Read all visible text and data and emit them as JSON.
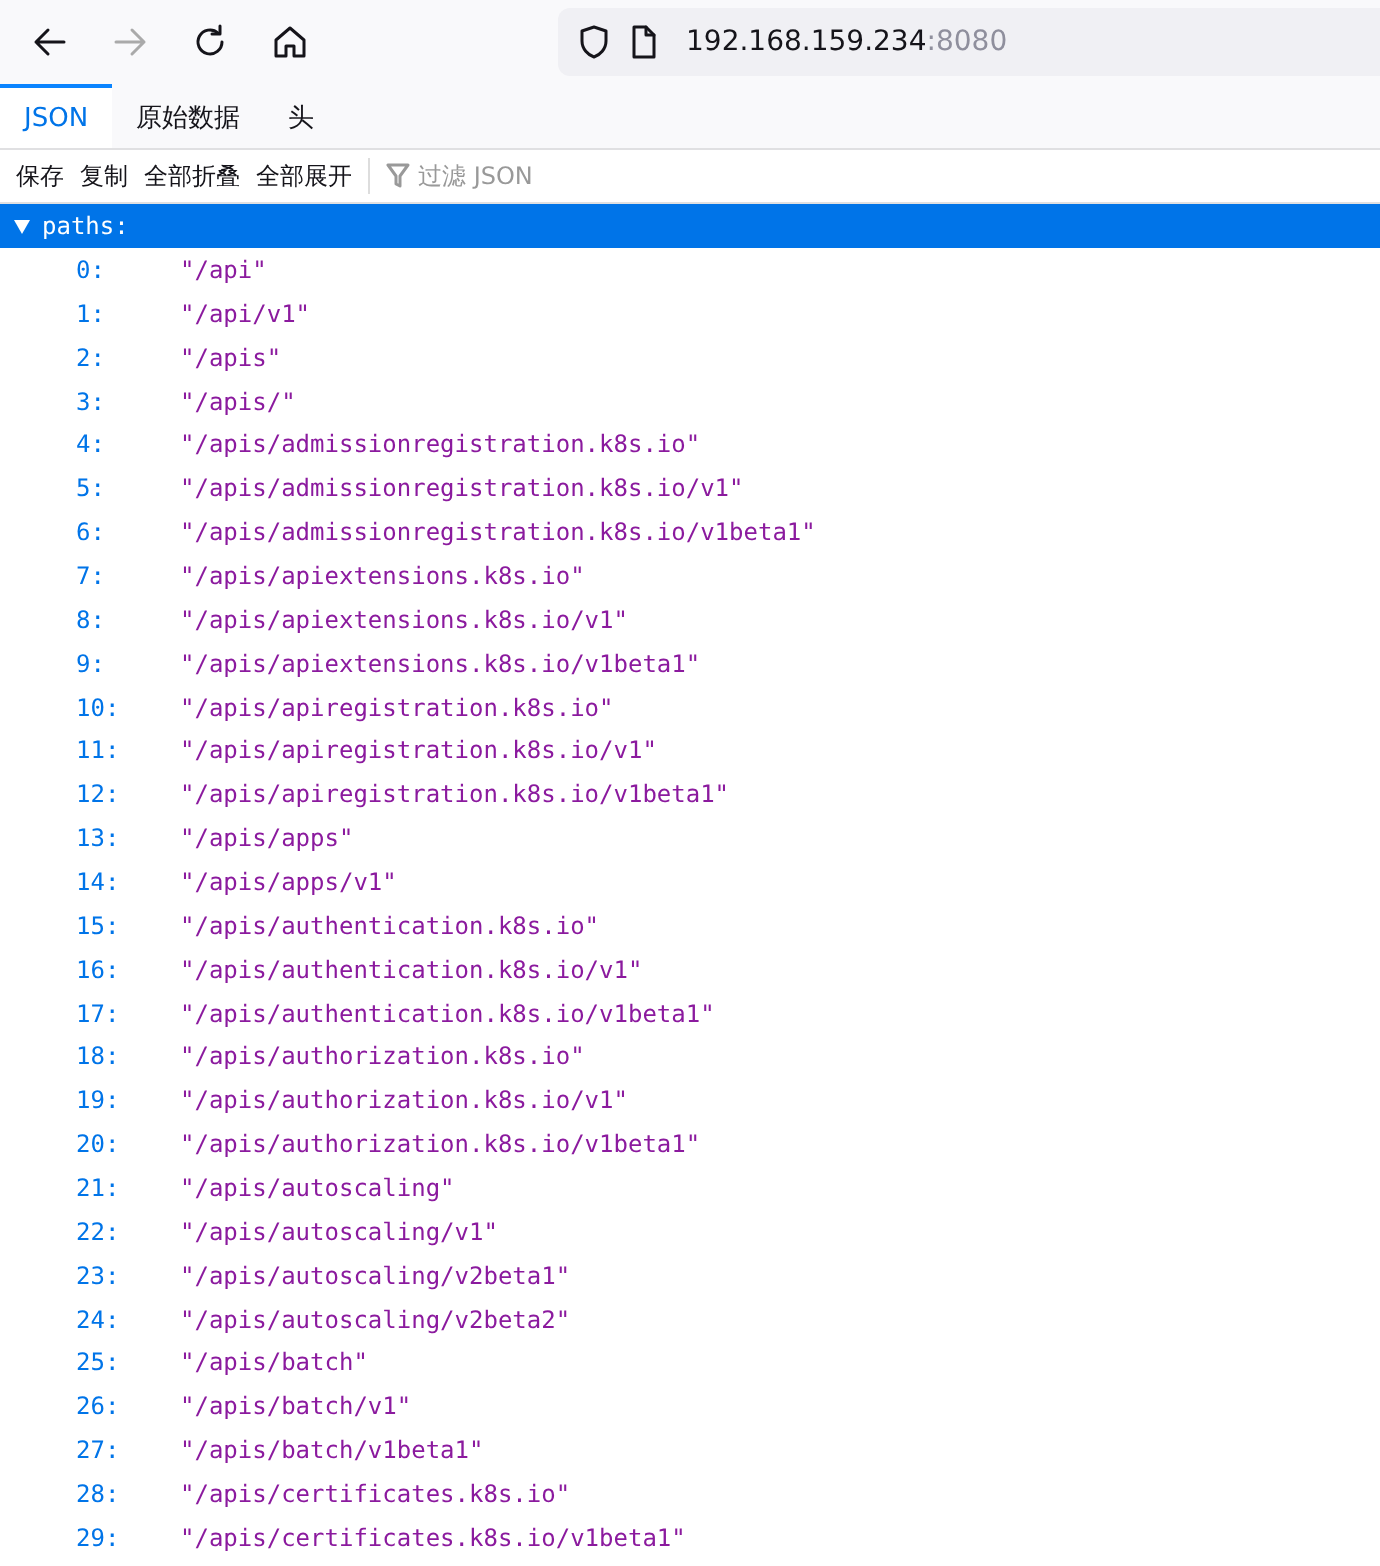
{
  "nav": {
    "host": "192.168.159.234",
    "port": ":8080",
    "back_disabled": false,
    "forward_disabled": true
  },
  "tabs": [
    {
      "label": "JSON",
      "selected": true
    },
    {
      "label": "原始数据",
      "selected": false
    },
    {
      "label": "头",
      "selected": false
    }
  ],
  "toolbar": {
    "buttons": [
      "保存",
      "复制",
      "全部折叠",
      "全部展开"
    ],
    "filter": {
      "placeholder": "过滤 JSON"
    }
  },
  "tree": {
    "key": "paths:",
    "expanded": true,
    "selected": true,
    "items": [
      {
        "index": "0:",
        "value": "\"/api\""
      },
      {
        "index": "1:",
        "value": "\"/api/v1\""
      },
      {
        "index": "2:",
        "value": "\"/apis\""
      },
      {
        "index": "3:",
        "value": "\"/apis/\""
      },
      {
        "index": "4:",
        "value": "\"/apis/admissionregistration.k8s.io\""
      },
      {
        "index": "5:",
        "value": "\"/apis/admissionregistration.k8s.io/v1\""
      },
      {
        "index": "6:",
        "value": "\"/apis/admissionregistration.k8s.io/v1beta1\""
      },
      {
        "index": "7:",
        "value": "\"/apis/apiextensions.k8s.io\""
      },
      {
        "index": "8:",
        "value": "\"/apis/apiextensions.k8s.io/v1\""
      },
      {
        "index": "9:",
        "value": "\"/apis/apiextensions.k8s.io/v1beta1\""
      },
      {
        "index": "10:",
        "value": "\"/apis/apiregistration.k8s.io\""
      },
      {
        "index": "11:",
        "value": "\"/apis/apiregistration.k8s.io/v1\""
      },
      {
        "index": "12:",
        "value": "\"/apis/apiregistration.k8s.io/v1beta1\""
      },
      {
        "index": "13:",
        "value": "\"/apis/apps\""
      },
      {
        "index": "14:",
        "value": "\"/apis/apps/v1\""
      },
      {
        "index": "15:",
        "value": "\"/apis/authentication.k8s.io\""
      },
      {
        "index": "16:",
        "value": "\"/apis/authentication.k8s.io/v1\""
      },
      {
        "index": "17:",
        "value": "\"/apis/authentication.k8s.io/v1beta1\""
      },
      {
        "index": "18:",
        "value": "\"/apis/authorization.k8s.io\""
      },
      {
        "index": "19:",
        "value": "\"/apis/authorization.k8s.io/v1\""
      },
      {
        "index": "20:",
        "value": "\"/apis/authorization.k8s.io/v1beta1\""
      },
      {
        "index": "21:",
        "value": "\"/apis/autoscaling\""
      },
      {
        "index": "22:",
        "value": "\"/apis/autoscaling/v1\""
      },
      {
        "index": "23:",
        "value": "\"/apis/autoscaling/v2beta1\""
      },
      {
        "index": "24:",
        "value": "\"/apis/autoscaling/v2beta2\""
      },
      {
        "index": "25:",
        "value": "\"/apis/batch\""
      },
      {
        "index": "26:",
        "value": "\"/apis/batch/v1\""
      },
      {
        "index": "27:",
        "value": "\"/apis/batch/v1beta1\""
      },
      {
        "index": "28:",
        "value": "\"/apis/certificates.k8s.io\""
      },
      {
        "index": "29:",
        "value": "\"/apis/certificates.k8s.io/v1beta1\""
      }
    ]
  }
}
